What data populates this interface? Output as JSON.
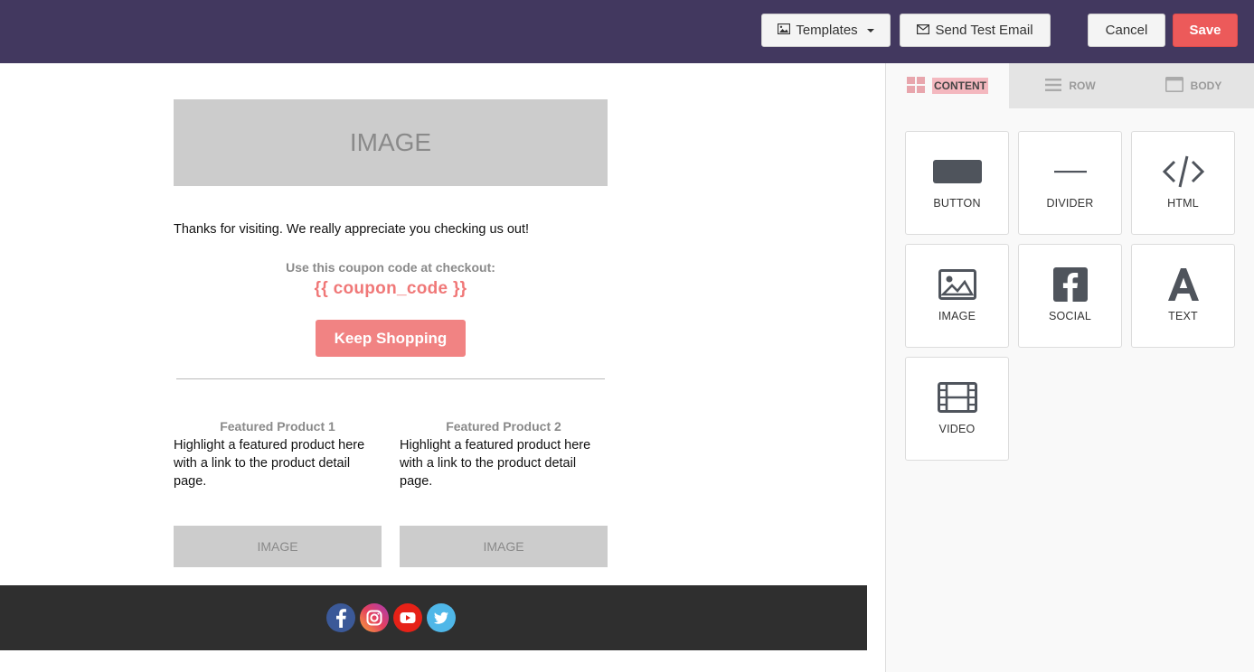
{
  "toolbar": {
    "templates_label": "Templates",
    "send_test_label": "Send Test Email",
    "cancel_label": "Cancel",
    "save_label": "Save"
  },
  "email": {
    "header_image_text": "IMAGE",
    "thanks_text": "Thanks for visiting. We really appreciate you checking us out!",
    "coupon_label": "Use this coupon code at checkout:",
    "coupon_code": "{{ coupon_code }}",
    "cta_label": "Keep Shopping",
    "products": [
      {
        "title": "Featured Product 1",
        "description": "Highlight a featured product here with a link to the product detail page.",
        "image_text": "IMAGE"
      },
      {
        "title": "Featured Product 2",
        "description": "Highlight a featured product here with a link to the product detail page.",
        "image_text": "IMAGE"
      }
    ],
    "social_icons": [
      "facebook-icon",
      "instagram-icon",
      "youtube-icon",
      "twitter-icon"
    ]
  },
  "sidebar": {
    "tabs": [
      {
        "label": "CONTENT",
        "icon": "grid-icon",
        "active": true
      },
      {
        "label": "ROW",
        "icon": "rows-icon",
        "active": false
      },
      {
        "label": "BODY",
        "icon": "body-icon",
        "active": false
      }
    ],
    "tiles": [
      {
        "label": "BUTTON",
        "icon": "button-icon"
      },
      {
        "label": "DIVIDER",
        "icon": "divider-icon"
      },
      {
        "label": "HTML",
        "icon": "code-icon"
      },
      {
        "label": "IMAGE",
        "icon": "image-icon"
      },
      {
        "label": "SOCIAL",
        "icon": "facebook-square-icon"
      },
      {
        "label": "TEXT",
        "icon": "text-icon"
      },
      {
        "label": "VIDEO",
        "icon": "film-icon"
      }
    ]
  },
  "colors": {
    "topbar": "#42385f",
    "save": "#ec5a5a",
    "accent_pink": "#f18383",
    "footer": "#2f2f2f"
  }
}
